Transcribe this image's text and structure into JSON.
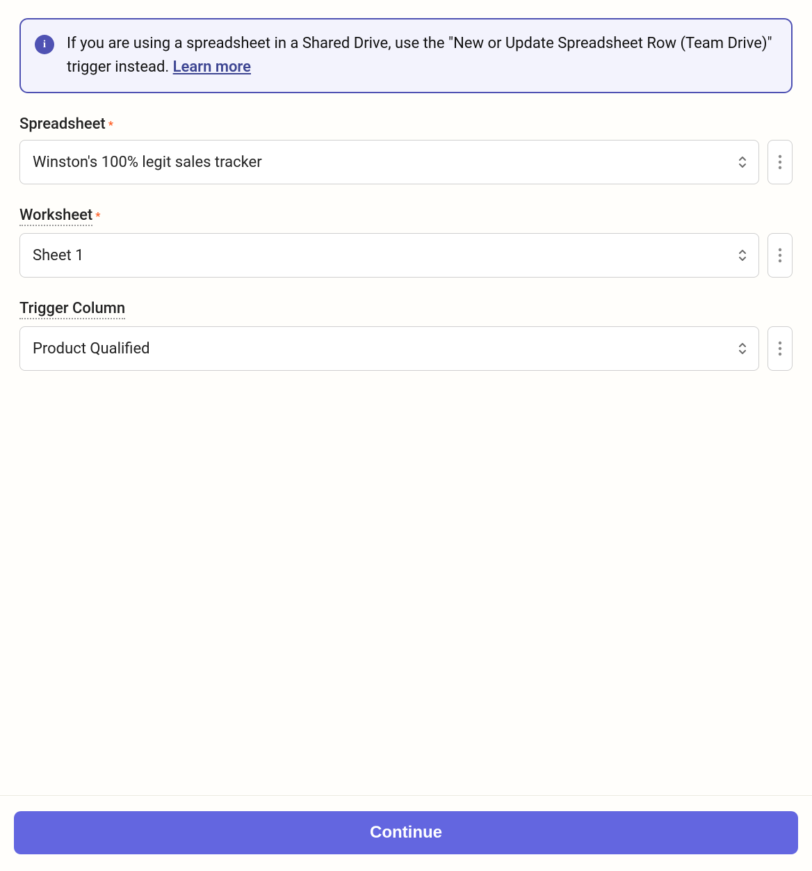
{
  "banner": {
    "text_before_link": "If you are using a spreadsheet in a Shared Drive, use the \"New or Update Spreadsheet Row (Team Drive)\" trigger instead. ",
    "link_text": "Learn more"
  },
  "fields": {
    "spreadsheet": {
      "label": "Spreadsheet",
      "required_mark": "*",
      "value": "Winston's 100% legit sales tracker"
    },
    "worksheet": {
      "label": "Worksheet",
      "required_mark": "*",
      "value": "Sheet 1"
    },
    "trigger_column": {
      "label": "Trigger Column",
      "value": "Product Qualified"
    }
  },
  "footer": {
    "continue_label": "Continue"
  }
}
